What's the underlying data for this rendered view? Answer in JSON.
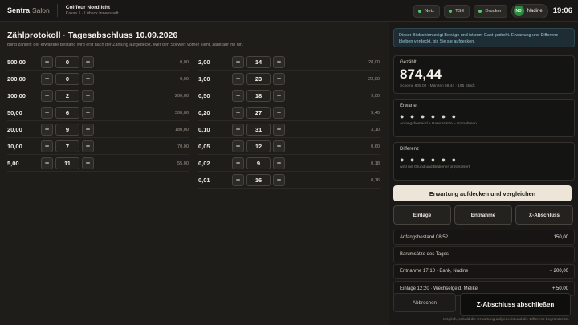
{
  "header": {
    "brand": "Sentra",
    "brand_suffix": "Salon",
    "shop_name": "Coiffeur Nordlicht",
    "register": "Kasse 1 · Lübeck Innenstadt",
    "status": [
      {
        "label": "Netz",
        "color": "#5ec46d"
      },
      {
        "label": "TSE",
        "color": "#5ec46d"
      },
      {
        "label": "Drucker",
        "color": "#5ec46d"
      }
    ],
    "user": {
      "initials": "ND",
      "name": "Nadine"
    },
    "time": "19:06"
  },
  "main": {
    "title": "Zählprotokoll · Tagesabschluss 10.09.2026",
    "subtitle": "Blind zählen: der erwartete Bestand wird erst nach der Zählung aufgedeckt. Wer den Sollwert vorher sieht, zählt auf ihn hin.",
    "decrement": "−",
    "increment": "+",
    "notes": [
      {
        "denom": "500,00",
        "qty": "0",
        "amount": "0,00"
      },
      {
        "denom": "200,00",
        "qty": "0",
        "amount": "0,00"
      },
      {
        "denom": "100,00",
        "qty": "2",
        "amount": "200,00"
      },
      {
        "denom": "50,00",
        "qty": "6",
        "amount": "300,00"
      },
      {
        "denom": "20,00",
        "qty": "9",
        "amount": "180,00"
      },
      {
        "denom": "10,00",
        "qty": "7",
        "amount": "70,00"
      },
      {
        "denom": "5,00",
        "qty": "11",
        "amount": "55,00"
      }
    ],
    "coins": [
      {
        "denom": "2,00",
        "qty": "14",
        "amount": "28,00"
      },
      {
        "denom": "1,00",
        "qty": "23",
        "amount": "23,00"
      },
      {
        "denom": "0,50",
        "qty": "18",
        "amount": "9,00"
      },
      {
        "denom": "0,20",
        "qty": "27",
        "amount": "5,40"
      },
      {
        "denom": "0,10",
        "qty": "31",
        "amount": "3,10"
      },
      {
        "denom": "0,05",
        "qty": "12",
        "amount": "0,60"
      },
      {
        "denom": "0,02",
        "qty": "9",
        "amount": "0,18"
      },
      {
        "denom": "0,01",
        "qty": "16",
        "amount": "0,16"
      }
    ]
  },
  "side": {
    "info": "Dieser Bildschirm zeigt Beträge und ist zum Gast gedreht. Erwartung und Differenz bleiben verdeckt, bis Sie sie aufdecken.",
    "counted_label": "Gezählt",
    "counted_value": "874,44",
    "counted_note": "Scheine 805,00 · Münzen 69,44 · 195 Stück",
    "expected_label": "Erwartet",
    "expected_mask": "● ● ● ● ● ●",
    "expected_note": "Anfangsbestand + Barumsätze − Entnahmen",
    "diff_label": "Differenz",
    "diff_mask": "● ● ● ● ● ●",
    "diff_note": "wird mit Grund und Bediener protokolliert",
    "reveal_button": "Erwartung aufdecken und vergleichen",
    "actions": [
      "Einlage",
      "Entnahme",
      "X-Abschluss"
    ],
    "entries": [
      {
        "label": "Anfangsbestand 08:52",
        "value": "150,00"
      },
      {
        "label": "Barumsätze des Tages",
        "value": "- - - - - -"
      },
      {
        "label": "Entnahme 17:10 · Bank, Nadine",
        "value": "− 200,00"
      },
      {
        "label": "Einlage 12:20 · Wechselgeld, Melike",
        "value": "+ 50,00"
      }
    ],
    "cancel": "Abbrechen",
    "z_button": "Z-Abschluss abschließen",
    "footnote": "Möglich, sobald die Erwartung aufgedeckt und die Differenz begründet ist."
  }
}
